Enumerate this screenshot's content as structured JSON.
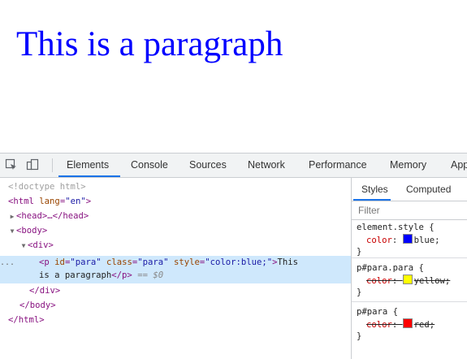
{
  "page": {
    "paragraph_text": "This is a paragraph",
    "paragraph_color": "#0000ff"
  },
  "toolbar": {
    "tabs": [
      "Elements",
      "Console",
      "Sources",
      "Network",
      "Performance",
      "Memory",
      "App"
    ],
    "active_tab": "Elements",
    "icons": [
      "inspect-element-icon",
      "device-toolbar-icon"
    ]
  },
  "elements_tree": {
    "doctype": "<!doctype html>",
    "html_open_tag": "html",
    "html_lang_attr": "lang",
    "html_lang_val": "\"en\"",
    "head_collapsed": "<head>…</head>",
    "body_open": "<body>",
    "div_open": "<div>",
    "p_tag": "p",
    "p_id_attr": "id",
    "p_id_val": "\"para\"",
    "p_class_attr": "class",
    "p_class_val": "\"para\"",
    "p_style_attr": "style",
    "p_style_val": "\"color:blue;\"",
    "p_text_1": "This",
    "p_text_2": "is a paragraph",
    "p_close": "</p>",
    "selected_marker": "== $0",
    "div_close": "</div>",
    "body_close": "</body>",
    "html_close": "</html>",
    "dots": "..."
  },
  "styles_pane": {
    "tabs": [
      "Styles",
      "Computed"
    ],
    "active_tab": "Styles",
    "filter_placeholder": "Filter",
    "rules": [
      {
        "selector": "element.style {",
        "property": "color",
        "value": "blue;",
        "swatch": "#0000ff",
        "overridden": false,
        "close": "}"
      },
      {
        "selector": "p#para.para {",
        "property": "color",
        "value": "yellow;",
        "swatch": "#ffff00",
        "overridden": true,
        "close": "}"
      },
      {
        "selector": "p#para {",
        "property": "color",
        "value": "red;",
        "swatch": "#ff0000",
        "overridden": true,
        "close": "}"
      }
    ]
  },
  "colors": {
    "accent": "#1a73e8",
    "selection": "#cfe8fc",
    "tag": "#881280",
    "attribute": "#994500",
    "attribute_value": "#1a1aa6"
  }
}
